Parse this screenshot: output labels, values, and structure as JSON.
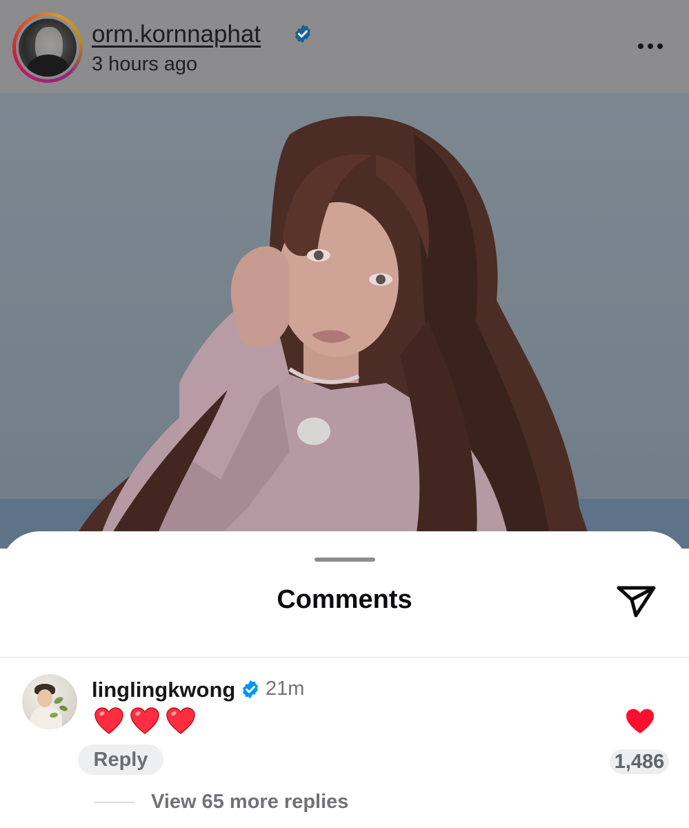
{
  "post": {
    "username": "orm.kornnaphat",
    "time_ago": "3 hours ago",
    "verified": true,
    "more_icon": "more-horizontal-icon"
  },
  "sheet": {
    "title": "Comments",
    "share_icon": "send-icon"
  },
  "comments": [
    {
      "username": "linglingkwong",
      "verified": true,
      "time": "21m",
      "text": "❤️❤️❤️",
      "reply_label": "Reply",
      "like_count": "1,486",
      "liked": true,
      "view_replies_label": "View 65 more replies"
    }
  ],
  "colors": {
    "verified_blue": "#0095f6",
    "heart_red": "#ff2d3f",
    "dim_overlay": "#8c8b8e"
  }
}
